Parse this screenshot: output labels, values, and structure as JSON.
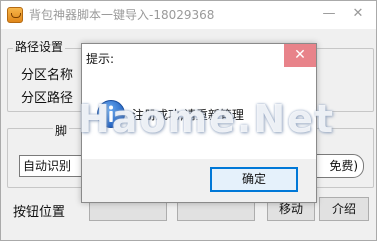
{
  "window": {
    "title": "背包神器脚本一键导入-18029368",
    "minimize_glyph": "—",
    "close_glyph": "✕"
  },
  "background": {
    "path_group_label": "路径设置",
    "partition_name_label": "分区名称",
    "partition_path_label": "分区路径",
    "bottom_group_label": "脚",
    "select_value": "自动识别",
    "free_button_label": "免费)",
    "button_position_label": "按钮位置",
    "btn_1_label": "",
    "btn_2_label": "",
    "btn_3_label": "移动",
    "intro_button_label": "介绍"
  },
  "dialog": {
    "title": "提示:",
    "close_glyph": "✕",
    "message": "注册成功,请重新管理",
    "ok_label": "确定",
    "icon": "info-icon"
  },
  "watermark": {
    "text": "Haome.Net"
  },
  "colors": {
    "dialog_close_bg": "#e8838a",
    "ok_button_border": "#0078d7",
    "info_icon_blue": "#1f6fd1"
  }
}
